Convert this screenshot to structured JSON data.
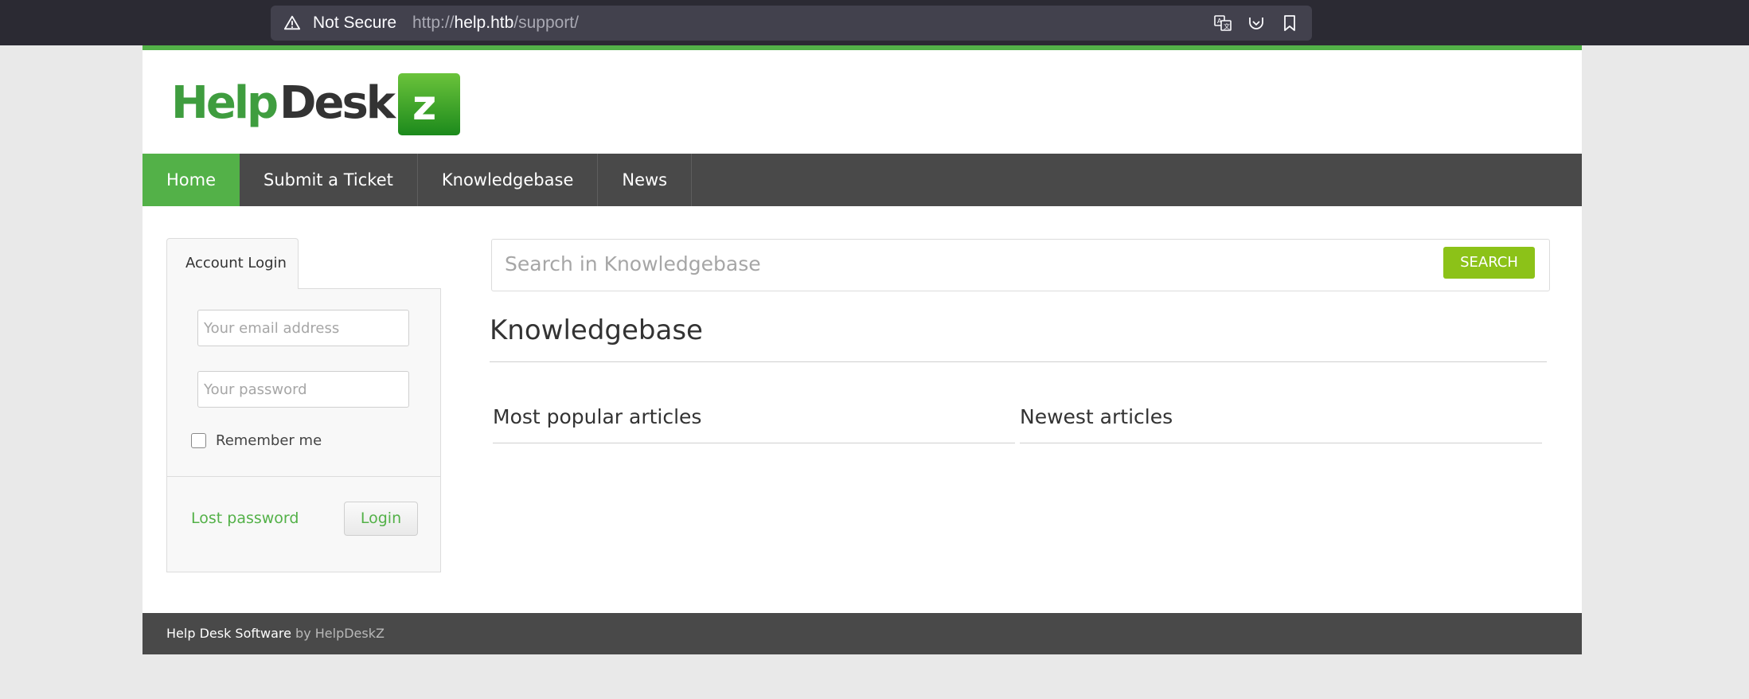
{
  "browser": {
    "security_label": "Not Secure",
    "url_scheme": "http://",
    "url_host": "help.htb",
    "url_path": "/support/"
  },
  "site": {
    "logo_text": "HelpDeskZ"
  },
  "nav": {
    "items": [
      {
        "label": "Home",
        "active": true
      },
      {
        "label": "Submit a Ticket"
      },
      {
        "label": "Knowledgebase"
      },
      {
        "label": "News"
      }
    ]
  },
  "login": {
    "tab_label": "Account Login",
    "email_placeholder": "Your email address",
    "password_placeholder": "Your password",
    "remember_label": "Remember me",
    "lost_password_label": "Lost password",
    "login_button": "Login"
  },
  "search": {
    "placeholder": "Search in Knowledgebase",
    "button_label": "SEARCH"
  },
  "knowledgebase": {
    "title": "Knowledgebase",
    "popular_title": "Most popular articles",
    "newest_title": "Newest articles"
  },
  "footer": {
    "software_label": "Help Desk Software",
    "by_label": "by HelpDeskZ"
  },
  "colors": {
    "brand_green": "#53b148",
    "search_green": "#8cc218",
    "nav_bg": "#494949"
  }
}
